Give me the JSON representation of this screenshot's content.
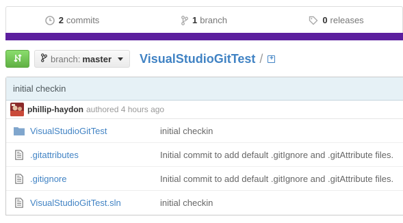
{
  "stats": {
    "commits": {
      "count": "2",
      "label": "commits",
      "icon": "history-icon"
    },
    "branches": {
      "count": "1",
      "label": "branch",
      "icon": "branch-icon"
    },
    "releases": {
      "count": "0",
      "label": "releases",
      "icon": "tag-icon"
    }
  },
  "language_bar": {
    "color": "#5c1f9e"
  },
  "toolbar": {
    "compare_icon": "compare-icon",
    "branch_label": "branch:",
    "branch_value": "master"
  },
  "repo": {
    "name": "VisualStudioGitTest",
    "separator": "/",
    "add_icon": "+"
  },
  "last_commit": {
    "message": "initial checkin",
    "author": "phillip-haydon",
    "authored_text": "authored 4 hours ago"
  },
  "files": [
    {
      "type": "directory",
      "icon": "folder-icon",
      "name": "VisualStudioGitTest",
      "message": "initial checkin"
    },
    {
      "type": "file",
      "icon": "file-icon",
      "name": ".gitattributes",
      "message": "Initial commit to add default .gitIgnore and .gitAttribute files."
    },
    {
      "type": "file",
      "icon": "file-icon",
      "name": ".gitignore",
      "message": "Initial commit to add default .gitIgnore and .gitAttribute files."
    },
    {
      "type": "file",
      "icon": "file-icon",
      "name": "VisualStudioGitTest.sln",
      "message": "initial checkin"
    }
  ]
}
